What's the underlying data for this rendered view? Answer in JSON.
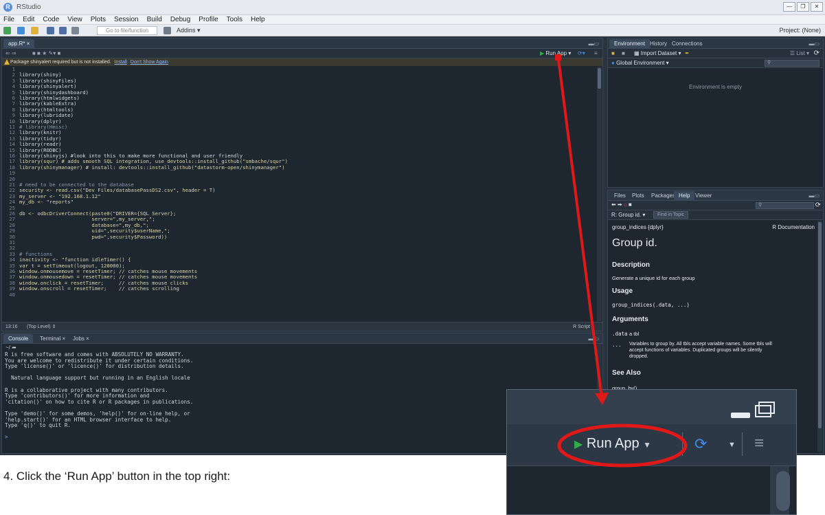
{
  "window": {
    "title": "RStudio",
    "menu": [
      "File",
      "Edit",
      "Code",
      "View",
      "Plots",
      "Session",
      "Build",
      "Debug",
      "Profile",
      "Tools",
      "Help"
    ],
    "goto_placeholder": "Go to file/function",
    "addins": "Addins",
    "project": "Project: (None)"
  },
  "editor": {
    "tab": "app.R*",
    "run_app": "Run App",
    "warning": "Package shinyalert required but is not installed.",
    "install": "Install",
    "dont_show": "Don't Show Again",
    "lines": [
      "",
      "library(shiny)",
      "library(shinyFiles)",
      "library(shinyalert)",
      "library(shinydashboard)",
      "library(htmlwidgets)",
      "library(kableExtra)",
      "library(htmltools)",
      "library(lubridate)",
      "library(dplyr)",
      "# library(Hmisc)",
      "library(knitr)",
      "library(tidyr)",
      "library(readr)",
      "library(RODBC)",
      "library(shinyjs) #look into this to make more functional and user friendly",
      "library(squr) # adds smooth SQL integration, use devtools::install_github(\"smbache/squr\")",
      "library(shinymanager) # install: devtools::install_github(\"datastorm-open/shinymanager\")",
      "",
      "",
      "# need to be connected to the database",
      "security <- read.csv(\"Dev Files/databasePassDS2.csv\", header = T)",
      "my_server <- \"192.168.1.12\"",
      "my_db <- \"reports\"",
      "",
      "db <- odbcDriverConnect(paste0(\"DRIVER={SQL Server};",
      "                        server=\",my_server,\";",
      "                        database=\",my_db,\";",
      "                        uid=\",security$userName,\";",
      "                        pwd=\",security$Password))",
      "",
      "",
      "# functions",
      "inactivity <- \"function idleTimer() {",
      "var t = setTimeout(logout, 120000);",
      "window.onmousemove = resetTimer; // catches mouse movements",
      "window.onmousedown = resetTimer; // catches mouse movements",
      "window.onclick = resetTimer;     // catches mouse clicks",
      "window.onscroll = resetTimer;    // catches scrolling",
      ""
    ],
    "status_pos": "13:16",
    "status_scope": "(Top Level)",
    "status_lang": "R Script"
  },
  "console": {
    "tabs": [
      "Console",
      "Terminal",
      "Jobs"
    ],
    "path": "~/",
    "lines": [
      "R is free software and comes with ABSOLUTELY NO WARRANTY.",
      "You are welcome to redistribute it under certain conditions.",
      "Type 'license()' or 'licence()' for distribution details.",
      "",
      "  Natural language support but running in an English locale",
      "",
      "R is a collaborative project with many contributors.",
      "Type 'contributors()' for more information and",
      "'citation()' on how to cite R or R packages in publications.",
      "",
      "Type 'demo()' for some demos, 'help()' for on-line help, or",
      "'help.start()' for an HTML browser interface to help.",
      "Type 'q()' to quit R.",
      "",
      "> "
    ]
  },
  "environment": {
    "tabs": [
      "Environment",
      "History",
      "Connections"
    ],
    "import": "Import Dataset",
    "list": "List",
    "global": "Global Environment",
    "empty": "Environment is empty"
  },
  "help": {
    "tabs": [
      "Files",
      "Plots",
      "Packages",
      "Help",
      "Viewer"
    ],
    "crumb": "R: Group id.",
    "find": "Find in Topic",
    "pkg": "group_indices {dplyr}",
    "rdoc": "R Documentation",
    "title": "Group id.",
    "h_desc": "Description",
    "desc": "Generate a unique id for each group",
    "h_usage": "Usage",
    "usage": "group_indices(.data, ...)",
    "h_args": "Arguments",
    "arg1_name": ".data",
    "arg1_desc": "a tbl",
    "arg2_name": "...",
    "arg2_desc_1": "Variables to group by. All tbls accept variable names. Some tbls will",
    "arg2_desc_2": "accept functions of variables. Duplicated groups will be silently",
    "arg2_desc_3": "dropped.",
    "h_see": "See Also",
    "see": "group_by()"
  },
  "caption": "4.   Click the ‘Run App’ button in the top right:",
  "zoom": {
    "run_app": "Run App"
  },
  "colors": {
    "annotation_red": "#e01818",
    "run_green": "#2fae4a",
    "publish_blue": "#3f8fe6"
  }
}
